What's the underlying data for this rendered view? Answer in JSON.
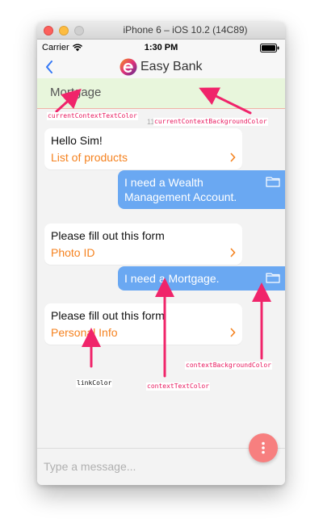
{
  "window": {
    "title": "iPhone 6 – iOS 10.2 (14C89)"
  },
  "status_bar": {
    "carrier": "Carrier",
    "time": "1:30 PM"
  },
  "nav": {
    "brand": "Easy Bank"
  },
  "context_banner": {
    "text": "Mortgage"
  },
  "chat": {
    "timestamp": "11:29 AM",
    "messages": [
      {
        "from": "bot",
        "text": "Hello Sim!",
        "link": "List of products"
      },
      {
        "from": "user",
        "text": "I need a Wealth Management Account."
      },
      {
        "from": "bot",
        "text": "Please fill out this form",
        "link": "Photo ID"
      },
      {
        "from": "user",
        "text": "I need a Mortgage."
      },
      {
        "from": "bot",
        "text": "Please fill out this form",
        "link": "Personal Info"
      }
    ]
  },
  "composer": {
    "placeholder": "Type a message..."
  },
  "annotations": {
    "current_context_text_color": "currentContextTextColor",
    "current_context_background_color": "currentContextBackgroundColor",
    "context_background_color": "contextBackgroundColor",
    "context_text_color": "contextTextColor",
    "link_color": "linkColor"
  },
  "colors": {
    "link": "#f5821f",
    "context_bubble": "#6aa8f2",
    "banner_background": "#e8f6dc",
    "fab": "#f77f7f",
    "annotation": "#e8175d"
  },
  "icons": [
    "back-chevron-icon",
    "wifi-icon",
    "battery-icon",
    "easy-bank-logo-icon",
    "chevron-right-icon",
    "folder-icon",
    "more-vertical-icon"
  ]
}
